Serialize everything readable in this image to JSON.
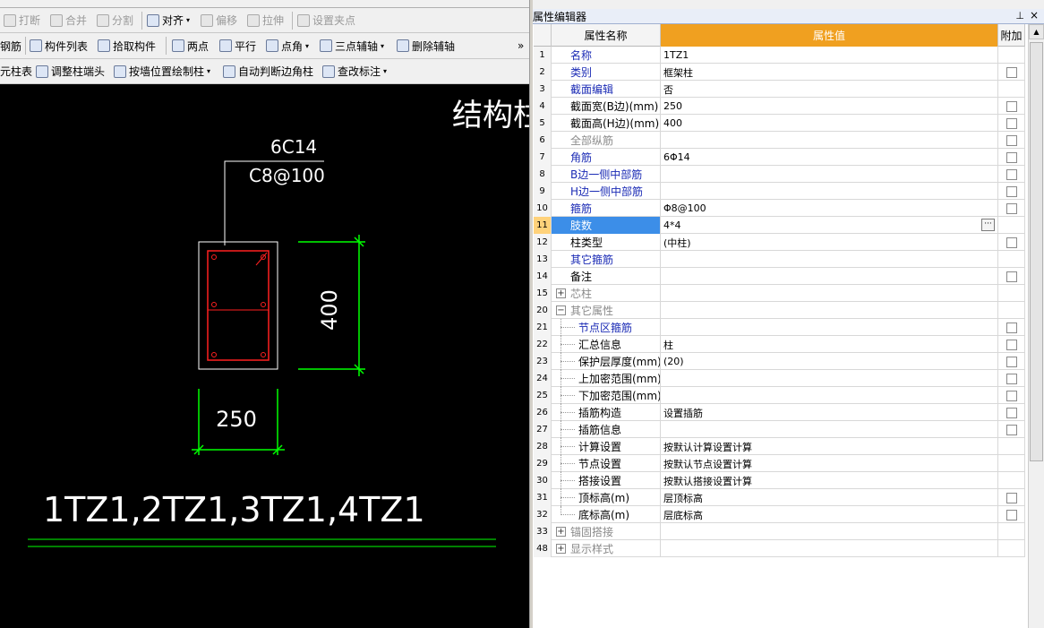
{
  "toolbar_top": {
    "edit": "打断",
    "merge": "合并",
    "split": "分割",
    "align": "对齐",
    "offset": "偏移",
    "stretch": "拉伸",
    "set_grip": "设置夹点"
  },
  "toolbar_mid": {
    "rebar": "钢筋",
    "component_list": "构件列表",
    "pick_component": "拾取构件",
    "two_points": "两点",
    "parallel": "平行",
    "point_angle": "点角",
    "three_point_axis": "三点辅轴",
    "delete_axis": "删除辅轴",
    "more": "»"
  },
  "toolbar_bot": {
    "column_table": "元柱表",
    "adjust_column_end": "调整柱端头",
    "draw_by_wall": "按墙位置绘制柱",
    "auto_corner": "自动判断边角柱",
    "modify_label": "查改标注"
  },
  "drawing": {
    "title_partial": "结构柱",
    "top_rebar": "6C14",
    "stirrup": "C8@100",
    "dim_height": "400",
    "dim_width": "250",
    "column_ids": "1TZ1,2TZ1,3TZ1,4TZ1",
    "colors": {
      "background": "#000000",
      "dimension": "#00ff00",
      "rebar": "#ff2020",
      "outline": "#ffffff"
    }
  },
  "panel": {
    "title": "属性编辑器",
    "pin_icon": "pin-icon",
    "close_label": "×",
    "header_name": "属性名称",
    "header_value": "属性值",
    "header_attach": "附加",
    "header_value_color": "#f0a020",
    "rows": [
      {
        "num": "1",
        "name": "名称",
        "value": "1TZ1",
        "style": "blue",
        "check": false
      },
      {
        "num": "2",
        "name": "类别",
        "value": "框架柱",
        "style": "blue",
        "check": true
      },
      {
        "num": "3",
        "name": "截面编辑",
        "value": "否",
        "style": "blue",
        "check": false
      },
      {
        "num": "4",
        "name": "截面宽(B边)(mm)",
        "value": "250",
        "style": "black",
        "check": true
      },
      {
        "num": "5",
        "name": "截面高(H边)(mm)",
        "value": "400",
        "style": "black",
        "check": true
      },
      {
        "num": "6",
        "name": "全部纵筋",
        "value": "",
        "style": "grey",
        "check": true
      },
      {
        "num": "7",
        "name": "角筋",
        "value": "6Φ14",
        "style": "blue",
        "check": true
      },
      {
        "num": "8",
        "name": "B边一侧中部筋",
        "value": "",
        "style": "blue",
        "check": true
      },
      {
        "num": "9",
        "name": "H边一侧中部筋",
        "value": "",
        "style": "blue",
        "check": true
      },
      {
        "num": "10",
        "name": "箍筋",
        "value": "Φ8@100",
        "style": "blue",
        "check": true
      },
      {
        "num": "11",
        "name": "肢数",
        "value": "4*4",
        "style": "sel",
        "check": false,
        "ellipsis": "···"
      },
      {
        "num": "12",
        "name": "柱类型",
        "value": "(中柱)",
        "style": "black",
        "check": true
      },
      {
        "num": "13",
        "name": "其它箍筋",
        "value": "",
        "style": "blue",
        "check": false
      },
      {
        "num": "14",
        "name": "备注",
        "value": "",
        "style": "black",
        "check": true
      },
      {
        "num": "15",
        "name": "芯柱",
        "value": "",
        "style": "group",
        "expander": "+",
        "check": false
      },
      {
        "num": "20",
        "name": "其它属性",
        "value": "",
        "style": "group",
        "expander": "−",
        "check": false
      },
      {
        "num": "21",
        "name": "节点区箍筋",
        "value": "",
        "style": "childblue",
        "check": true
      },
      {
        "num": "22",
        "name": "汇总信息",
        "value": "柱",
        "style": "child",
        "check": true
      },
      {
        "num": "23",
        "name": "保护层厚度(mm)",
        "value": "(20)",
        "style": "child",
        "check": true
      },
      {
        "num": "24",
        "name": "上加密范围(mm)",
        "value": "",
        "style": "child",
        "check": true
      },
      {
        "num": "25",
        "name": "下加密范围(mm)",
        "value": "",
        "style": "child",
        "check": true
      },
      {
        "num": "26",
        "name": "插筋构造",
        "value": "设置插筋",
        "style": "child",
        "check": true
      },
      {
        "num": "27",
        "name": "插筋信息",
        "value": "",
        "style": "child",
        "check": true
      },
      {
        "num": "28",
        "name": "计算设置",
        "value": "按默认计算设置计算",
        "style": "child",
        "check": false
      },
      {
        "num": "29",
        "name": "节点设置",
        "value": "按默认节点设置计算",
        "style": "child",
        "check": false
      },
      {
        "num": "30",
        "name": "搭接设置",
        "value": "按默认搭接设置计算",
        "style": "child",
        "check": false
      },
      {
        "num": "31",
        "name": "顶标高(m)",
        "value": "层顶标高",
        "style": "child",
        "check": true
      },
      {
        "num": "32",
        "name": "底标高(m)",
        "value": "层底标高",
        "style": "childlast",
        "check": true
      },
      {
        "num": "33",
        "name": "锚固搭接",
        "value": "",
        "style": "group",
        "expander": "+",
        "check": false
      },
      {
        "num": "48",
        "name": "显示样式",
        "value": "",
        "style": "group",
        "expander": "+",
        "check": false
      }
    ]
  }
}
